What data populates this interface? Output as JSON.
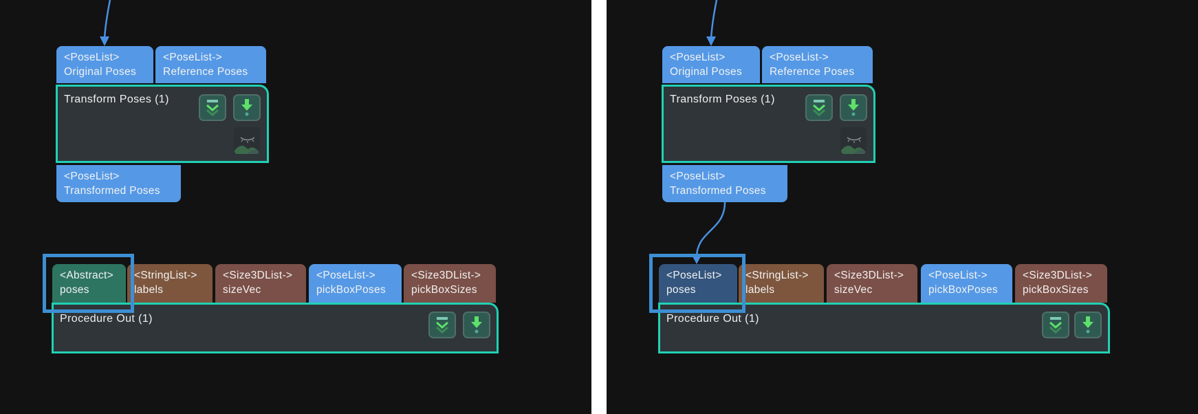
{
  "colors": {
    "background": "#121212",
    "node_border": "#20d1b4",
    "node_body": "#30353a",
    "port_poselist": "#5599e6",
    "port_stringlist": "#7d563d",
    "port_size3dlist": "#7b5048",
    "port_abstract": "#2e7561",
    "port_poselist_connected": "#34557d",
    "wire": "#4a90e2",
    "highlight": "#3d8fd4"
  },
  "panels": [
    {
      "id": "before",
      "transform_node": {
        "title": "Transform Poses (1)",
        "inputs": [
          {
            "type": "<PoseList>",
            "name": "Original Poses"
          },
          {
            "type": "<PoseList->",
            "name": "Reference Poses"
          }
        ],
        "output": {
          "type": "<PoseList>",
          "name": "Transformed Poses"
        },
        "buttons": [
          "collapse-icon",
          "download-icon"
        ],
        "image_toggle": "hidden-image-icon"
      },
      "procedure_node": {
        "title": "Procedure Out (1)",
        "inputs": [
          {
            "type": "<Abstract>",
            "name": "poses"
          },
          {
            "type": "<StringList->",
            "name": "labels"
          },
          {
            "type": "<Size3DList->",
            "name": "sizeVec"
          },
          {
            "type": "<PoseList->",
            "name": "pickBoxPoses"
          },
          {
            "type": "<Size3DList->",
            "name": "pickBoxSizes"
          }
        ],
        "buttons": [
          "collapse-icon",
          "download-icon"
        ]
      },
      "connected_output_to_poses": false
    },
    {
      "id": "after",
      "transform_node": {
        "title": "Transform Poses (1)",
        "inputs": [
          {
            "type": "<PoseList>",
            "name": "Original Poses"
          },
          {
            "type": "<PoseList->",
            "name": "Reference Poses"
          }
        ],
        "output": {
          "type": "<PoseList>",
          "name": "Transformed Poses"
        },
        "buttons": [
          "collapse-icon",
          "download-icon"
        ],
        "image_toggle": "hidden-image-icon"
      },
      "procedure_node": {
        "title": "Procedure Out (1)",
        "inputs": [
          {
            "type": "<PoseList>",
            "name": "poses"
          },
          {
            "type": "<StringList->",
            "name": "labels"
          },
          {
            "type": "<Size3DList->",
            "name": "sizeVec"
          },
          {
            "type": "<PoseList->",
            "name": "pickBoxPoses"
          },
          {
            "type": "<Size3DList->",
            "name": "pickBoxSizes"
          }
        ],
        "buttons": [
          "collapse-icon",
          "download-icon"
        ]
      },
      "connected_output_to_poses": true
    }
  ]
}
